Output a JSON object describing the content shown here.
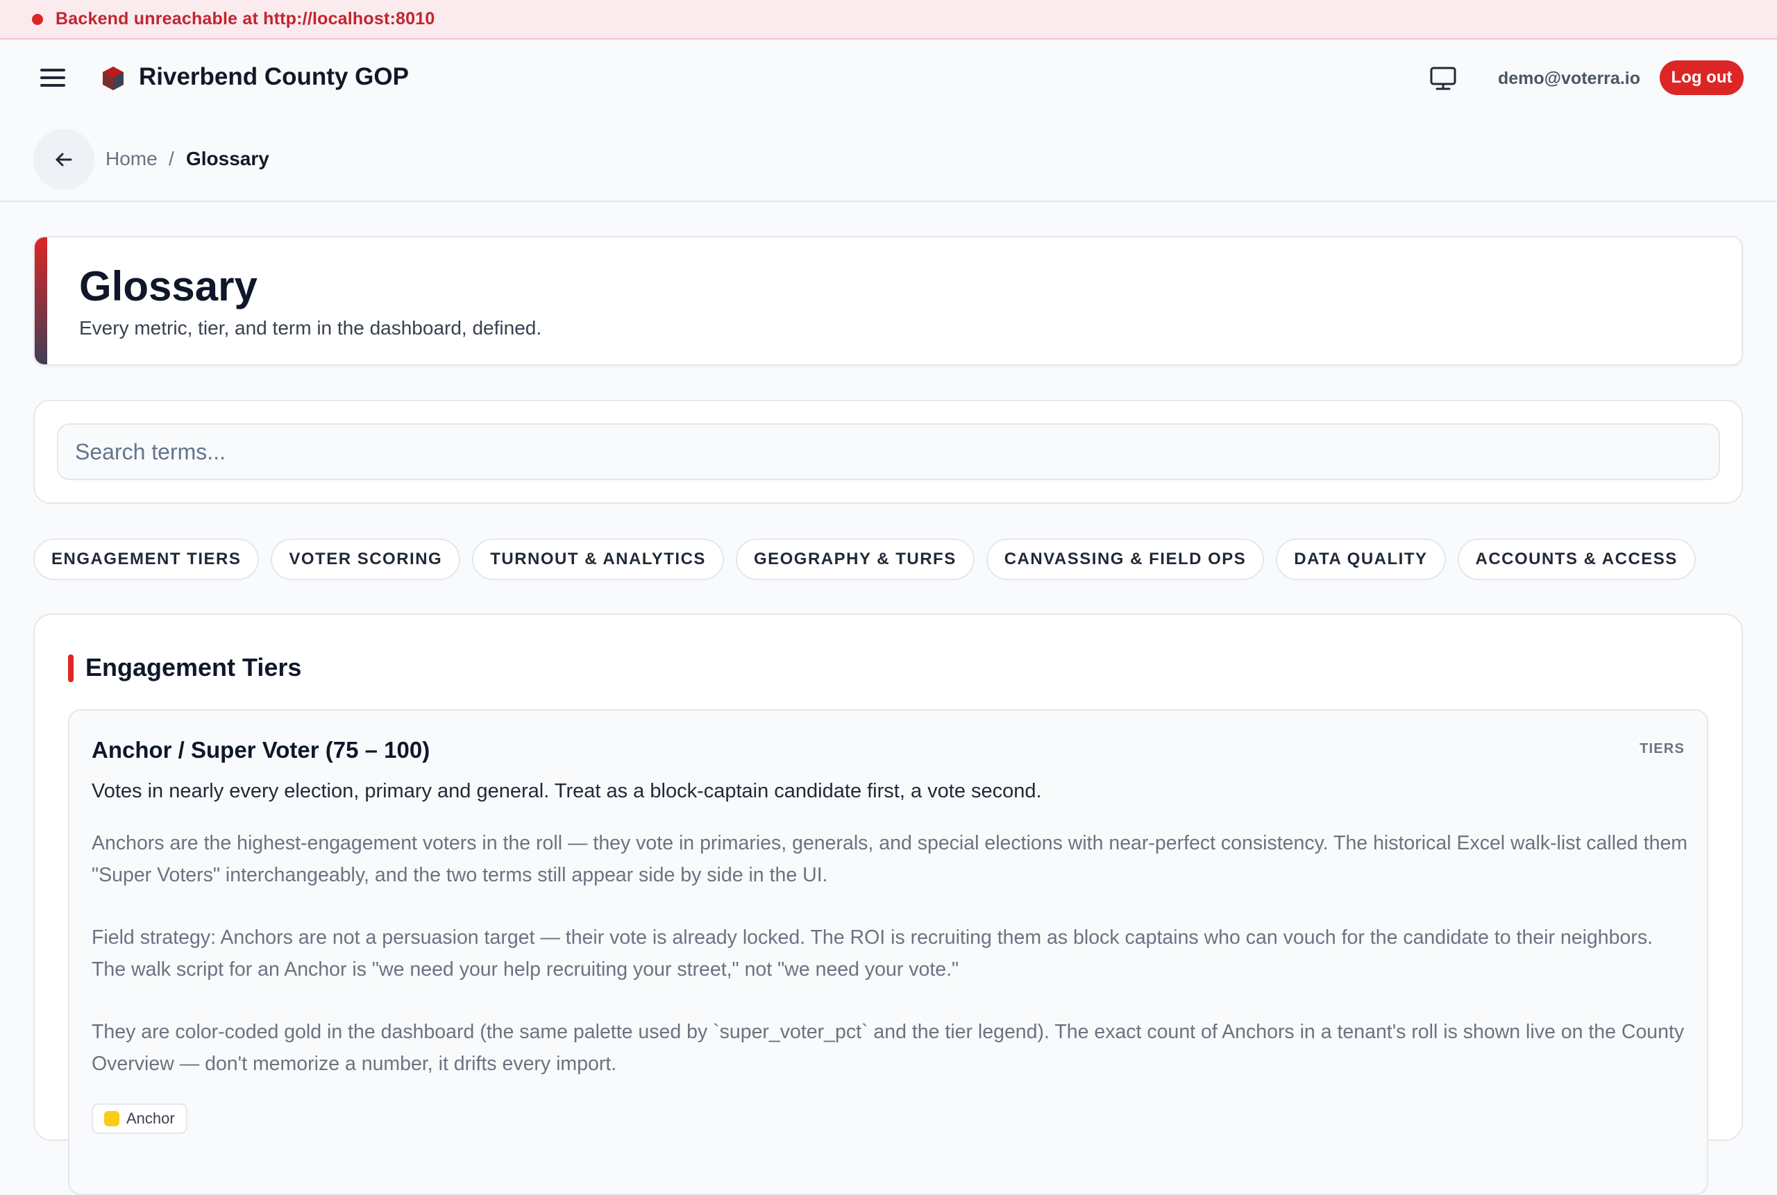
{
  "banner": {
    "message": "Backend unreachable at http://localhost:8010"
  },
  "header": {
    "org_name": "Riverbend County GOP",
    "user_email": "demo@voterra.io",
    "logout_label": "Log out"
  },
  "breadcrumb": {
    "home": "Home",
    "separator": "/",
    "current": "Glossary"
  },
  "page": {
    "title": "Glossary",
    "subtitle": "Every metric, tier, and term in the dashboard, defined."
  },
  "search": {
    "placeholder": "Search terms..."
  },
  "categories": [
    "ENGAGEMENT TIERS",
    "VOTER SCORING",
    "TURNOUT & ANALYTICS",
    "GEOGRAPHY & TURFS",
    "CANVASSING & FIELD OPS",
    "DATA QUALITY",
    "ACCOUNTS & ACCESS"
  ],
  "section": {
    "title": "Engagement Tiers",
    "term": {
      "title": "Anchor / Super Voter (75 – 100)",
      "tag": "TIERS",
      "short": "Votes in nearly every election, primary and general. Treat as a block-captain candidate first, a vote second.",
      "paragraphs": [
        "Anchors are the highest-engagement voters in the roll — they vote in primaries, generals, and special elections with near-perfect consistency. The historical Excel walk-list called them \"Super Voters\" interchangeably, and the two terms still appear side by side in the UI.",
        "Field strategy: Anchors are not a persuasion target — their vote is already locked. The ROI is recruiting them as block captains who can vouch for the candidate to their neighbors. The walk script for an Anchor is \"we need your help recruiting your street,\" not \"we need your vote.\"",
        "They are color-coded gold in the dashboard (the same palette used by `super_voter_pct` and the tier legend). The exact count of Anchors in a tenant's roll is shown live on the County Overview — don't memorize a number, it drifts every import."
      ],
      "badge": "Anchor"
    }
  },
  "colors": {
    "accent": "#dc2626",
    "banner_bg": "#fbeaee",
    "tier_gold": "#facc15"
  }
}
